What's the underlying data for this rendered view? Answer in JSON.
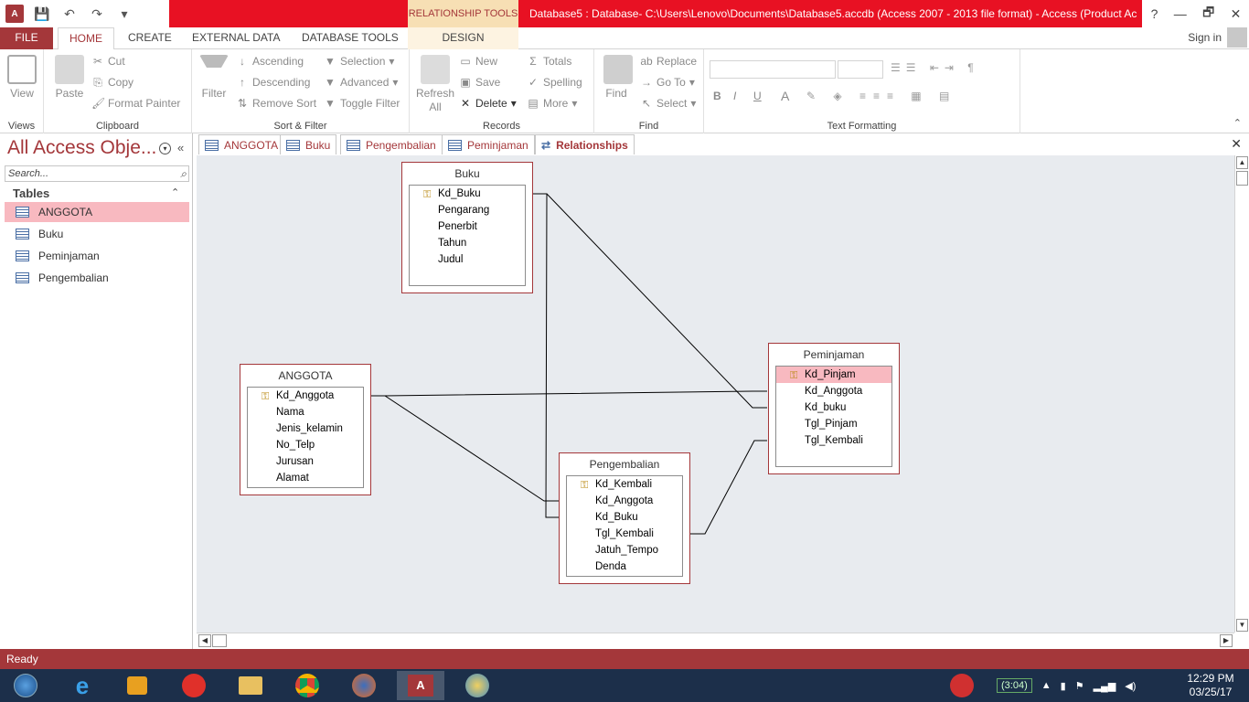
{
  "window": {
    "context_tab": "RELATIONSHIP TOOLS",
    "title": "Database5 : Database- C:\\Users\\Lenovo\\Documents\\Database5.accdb (Access 2007 - 2013 file format) -  Access (Product Ac...",
    "help": "?",
    "restore": "🗗",
    "close": "✕"
  },
  "ribbon_tabs": {
    "file": "FILE",
    "home": "HOME",
    "create": "CREATE",
    "external": "EXTERNAL DATA",
    "dbtools": "DATABASE TOOLS",
    "design": "DESIGN",
    "signin": "Sign in"
  },
  "ribbon": {
    "views": {
      "view": "View",
      "label": "Views"
    },
    "clipboard": {
      "paste": "Paste",
      "cut": "Cut",
      "copy": "Copy",
      "format_painter": "Format Painter",
      "label": "Clipboard"
    },
    "sort_filter": {
      "filter": "Filter",
      "ascending": "Ascending",
      "descending": "Descending",
      "remove_sort": "Remove Sort",
      "selection": "Selection",
      "advanced": "Advanced",
      "toggle_filter": "Toggle Filter",
      "label": "Sort & Filter"
    },
    "records": {
      "refresh": "Refresh",
      "refresh_all": "All",
      "new": "New",
      "save": "Save",
      "delete": "Delete",
      "totals": "Totals",
      "spelling": "Spelling",
      "more": "More",
      "label": "Records"
    },
    "find": {
      "find": "Find",
      "replace": "Replace",
      "goto": "Go To",
      "select": "Select",
      "label": "Find"
    },
    "text_formatting": {
      "bold": "B",
      "italic": "I",
      "underline": "U",
      "font_color": "A",
      "label": "Text Formatting"
    }
  },
  "nav": {
    "title": "All Access Obje...",
    "search_placeholder": "Search...",
    "section": "Tables",
    "items": [
      "ANGGOTA",
      "Buku",
      "Peminjaman",
      "Pengembalian"
    ]
  },
  "doc_tabs": [
    "ANGGOTA",
    "Buku",
    "Pengembalian",
    "Peminjaman",
    "Relationships"
  ],
  "tables": {
    "buku": {
      "title": "Buku",
      "fields": [
        "Kd_Buku",
        "Pengarang",
        "Penerbit",
        "Tahun",
        "Judul"
      ]
    },
    "anggota": {
      "title": "ANGGOTA",
      "fields": [
        "Kd_Anggota",
        "Nama",
        "Jenis_kelamin",
        "No_Telp",
        "Jurusan",
        "Alamat"
      ]
    },
    "peminjaman": {
      "title": "Peminjaman",
      "fields": [
        "Kd_Pinjam",
        "Kd_Anggota",
        "Kd_buku",
        "Tgl_Pinjam",
        "Tgl_Kembali"
      ]
    },
    "pengembalian": {
      "title": "Pengembalian",
      "fields": [
        "Kd_Kembali",
        "Kd_Anggota",
        "Kd_Buku",
        "Tgl_Kembali",
        "Jatuh_Tempo",
        "Denda"
      ]
    }
  },
  "status": "Ready",
  "tray": {
    "battery": "(3:04)",
    "time": "12:29 PM",
    "date": "03/25/17"
  },
  "colors": {
    "accent": "#a4373a",
    "titlebar_red": "#e81123",
    "selection_pink": "#f8b9c0",
    "canvas": "#e8ebef"
  }
}
